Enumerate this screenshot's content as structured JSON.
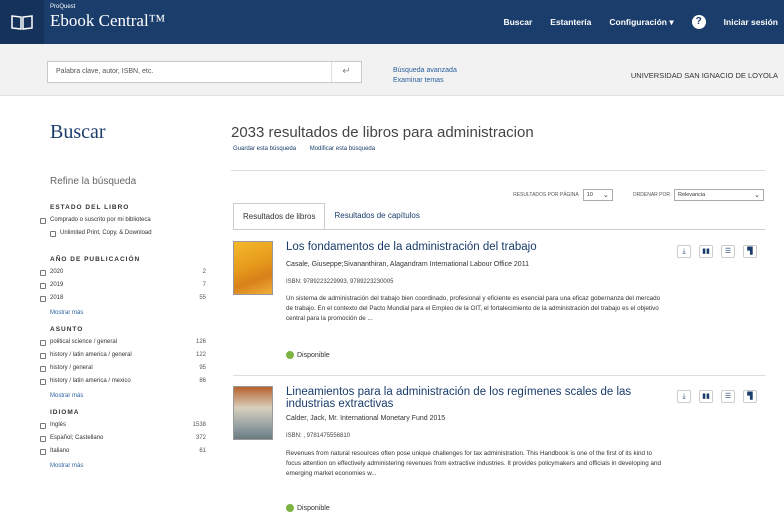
{
  "header": {
    "brand_small": "ProQuest",
    "brand_title": "Ebook Central™",
    "nav": [
      "Buscar",
      "Estantería",
      "Configuración",
      "Iniciar sesión"
    ]
  },
  "search": {
    "placeholder": "Palabra clave, autor, ISBN, etc.",
    "advanced_link": "Búsqueda avanzada",
    "browse_link": "Examinar temas",
    "institution": "UNIVERSIDAD SAN IGNACIO DE LOYOLA"
  },
  "page": {
    "heading": "Buscar",
    "results_count": "2033",
    "results_text": "resultados de libros para administracion",
    "save_search": "Guardar esta búsqueda",
    "modify_search": "Modificar esta búsqueda"
  },
  "sidebar": {
    "refine_title": "Refine la búsqueda",
    "show_more": "Mostrar más",
    "estado": {
      "title": "ESTADO DEL LIBRO",
      "items": [
        {
          "label": "Comprado o suscrito por mi biblioteca"
        },
        {
          "label": "Unlimited Print, Copy, & Download"
        }
      ]
    },
    "anio": {
      "title": "AÑO DE PUBLICACIÓN",
      "items": [
        {
          "label": "2020",
          "count": "2"
        },
        {
          "label": "2019",
          "count": "7"
        },
        {
          "label": "2018",
          "count": "55"
        }
      ]
    },
    "asunto": {
      "title": "ASUNTO",
      "items": [
        {
          "label": "political science / general",
          "count": "126"
        },
        {
          "label": "history / latin america / general",
          "count": "122"
        },
        {
          "label": "history / general",
          "count": "95"
        },
        {
          "label": "history / latin america / mexico",
          "count": "86"
        }
      ]
    },
    "idioma": {
      "title": "IDIOMA",
      "items": [
        {
          "label": "Inglés",
          "count": "1538"
        },
        {
          "label": "Español; Castellano",
          "count": "372"
        },
        {
          "label": "Italiano",
          "count": "61"
        }
      ]
    }
  },
  "controls": {
    "per_page_label": "RESULTADOS POR PÁGINA",
    "per_page_value": "10",
    "sort_label": "ORDENAR POR",
    "sort_value": "Relevancia"
  },
  "tabs": [
    "Resultados de libros",
    "Resultados de capítulos"
  ],
  "results": [
    {
      "title": "Los fondamentos de la administración del trabajo",
      "authors": "Casale, Giuseppe;Sivananthiran, Alagandram  International Labour Office  2011",
      "isbn": "ISBN: 9789223229993, 9789223230005",
      "description": "Un sistema de administración del trabajo bien coordinado, profesional y eficiente es esencial para una eficaz gobernanza del mercado de trabajo. En el contexto del Pacto Mundial para el Empleo de la OIT, el fortalecimiento de la administración del trabajo es el objetivo central para la promoción de ...",
      "availability": "Disponible"
    },
    {
      "title": "Lineamientos para la administración de los regímenes scales de las industrias extractivas",
      "authors": "Calder, Jack, Mr.  International Monetary Fund  2015",
      "isbn": "ISBN: , 9781475556810",
      "description": "Revenues from natural resources often pose unique challenges for tax administration. This Handbook is one of the first of its kind to focus attention on effectively administering revenues from extractive industries. It provides policymakers and officials in developing and emerging market economies w...",
      "availability": "Disponible"
    }
  ],
  "colors": {
    "header_bg": "#1a3d6b",
    "link": "#2a5f9e",
    "available": "#7cb342"
  },
  "icons": [
    "book-logo-icon",
    "help-icon",
    "enter-icon",
    "download-icon",
    "read-icon",
    "list-icon",
    "bookmark-icon",
    "dropdown-caret-icon"
  ]
}
